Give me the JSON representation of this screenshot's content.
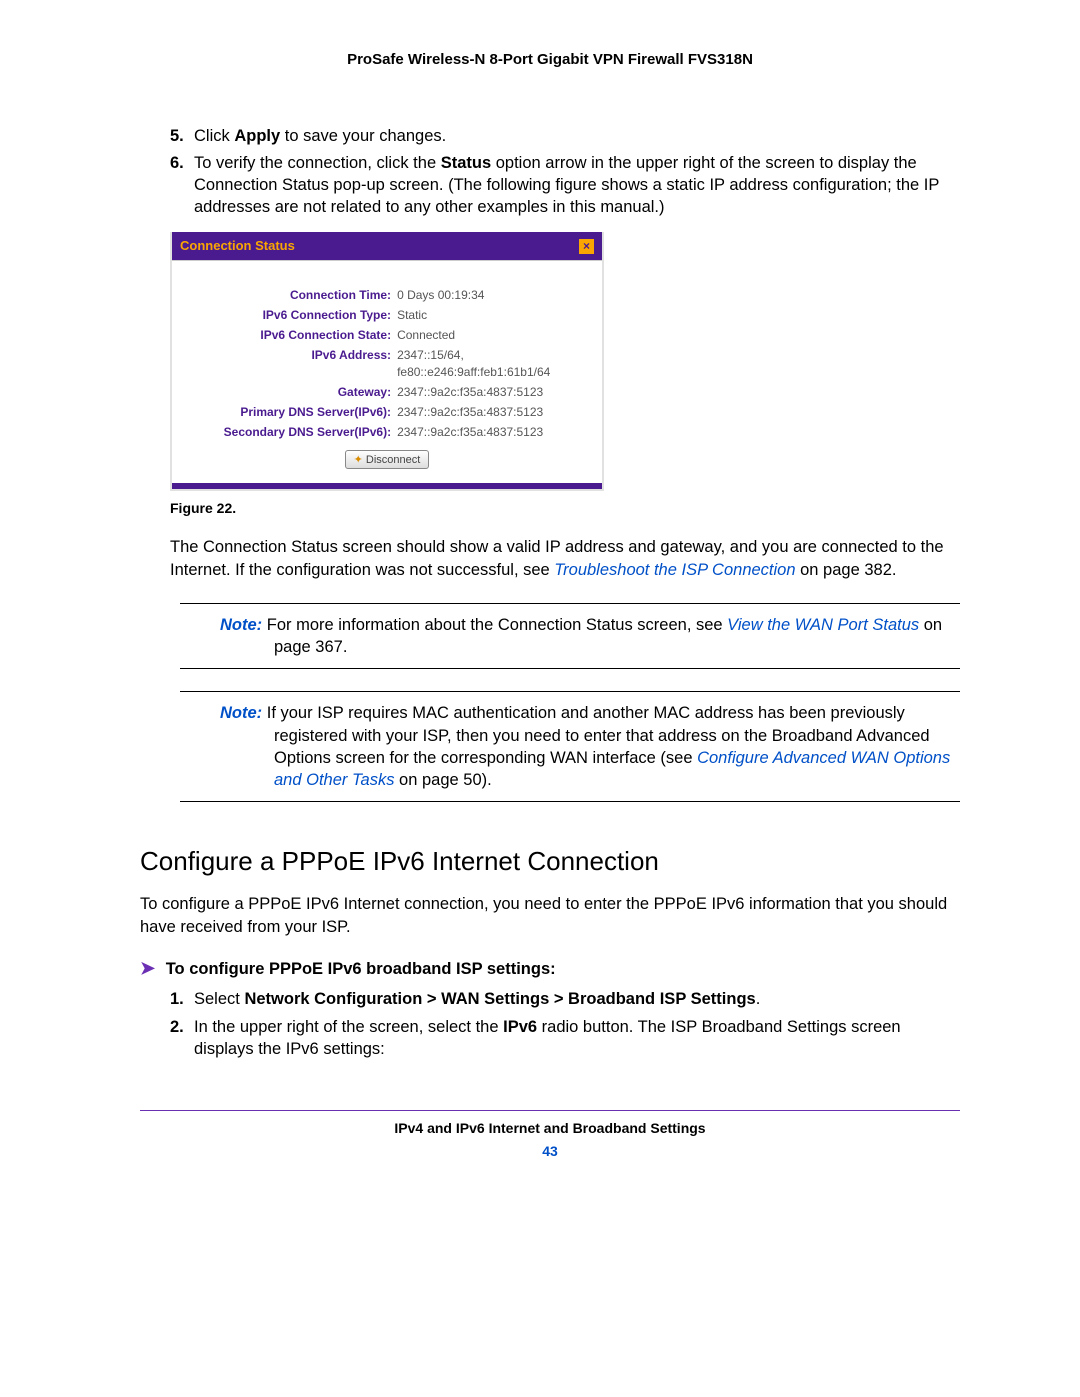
{
  "header": "ProSafe Wireless-N 8-Port Gigabit VPN Firewall FVS318N",
  "step5_pre": "Click ",
  "step5_bold": "Apply",
  "step5_post": " to save your changes.",
  "step6_a": "To verify the connection, click the ",
  "step6_bold": "Status",
  "step6_b": " option arrow in the upper right of the screen to display the Connection Status pop-up screen. (The following figure shows a static IP address configuration; the IP addresses are not related to any other examples in this manual.)",
  "dialog": {
    "title": "Connection Status",
    "rows": [
      {
        "label": "Connection Time:",
        "value": "0 Days 00:19:34"
      },
      {
        "label": "IPv6 Connection Type:",
        "value": "Static"
      },
      {
        "label": "IPv6 Connection State:",
        "value": "Connected"
      },
      {
        "label": "IPv6 Address:",
        "value": "2347::15/64,\nfe80::e246:9aff:feb1:61b1/64"
      },
      {
        "label": "Gateway:",
        "value": "2347::9a2c:f35a:4837:5123"
      },
      {
        "label": "Primary DNS Server(IPv6):",
        "value": "2347::9a2c:f35a:4837:5123"
      },
      {
        "label": "Secondary DNS Server(IPv6):",
        "value": "2347::9a2c:f35a:4837:5123"
      }
    ],
    "disconnect": "Disconnect"
  },
  "figcaption": "Figure 22.",
  "para1_a": "The Connection Status screen should show a valid IP address and gateway, and you are connected to the Internet. If the configuration was not successful, see ",
  "para1_link": "Troubleshoot the ISP Connection",
  "para1_b": " on page 382.",
  "note1_label": "Note:",
  "note1_a": "  For more information about the Connection Status screen, see ",
  "note1_link": "View the WAN Port Status",
  "note1_b": " on page 367.",
  "note2_label": "Note:",
  "note2_a": "  If your ISP requires MAC authentication and another MAC address has been previously registered with your ISP, then you need to enter that address on the Broadband Advanced Options screen for the corresponding WAN interface (see ",
  "note2_link": "Configure Advanced WAN Options and Other Tasks",
  "note2_b": " on page 50).",
  "h2": "Configure a PPPoE IPv6 Internet Connection",
  "intro": "To configure a PPPoE IPv6 Internet connection, you need to enter the PPPoE IPv6 information that you should have received from your ISP.",
  "proc_heading": "To configure PPPoE IPv6 broadband ISP settings:",
  "pstep1_a": "Select ",
  "pstep1_bold": "Network Configuration > WAN Settings > Broadband ISP Settings",
  "pstep1_b": ".",
  "pstep2_a": "In the upper right of the screen, select the ",
  "pstep2_bold": "IPv6",
  "pstep2_b": " radio button. The ISP Broadband Settings screen displays the IPv6 settings:",
  "footer_chapter": "IPv4 and IPv6 Internet and Broadband Settings",
  "footer_page": "43"
}
